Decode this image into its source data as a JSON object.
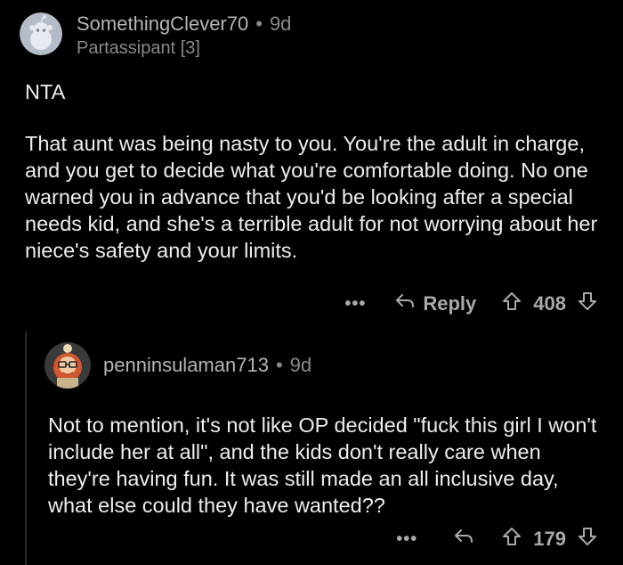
{
  "comment_1": {
    "author": "SomethingClever70",
    "separator": "•",
    "age": "9d",
    "flair": "Partassipant [3]",
    "paragraphs": [
      "NTA",
      "That aunt was being nasty to you. You're the adult in charge, and you get to decide what you're comfortable doing. No one warned you in advance that you'd be looking after a special needs kid, and she's a terrible adult for not worrying about her niece's safety and your limits."
    ],
    "more_label": "•••",
    "reply_label": "Reply",
    "score": "408"
  },
  "comment_2": {
    "author": "penninsulaman713",
    "separator": "•",
    "age": "9d",
    "text": "Not to mention, it's not like OP decided \"fuck this girl I won't include her at all\", and the kids don't really care when they're having fun. It was still made an all inclusive day, what else could they have wanted??",
    "more_label": "•••",
    "score": "179"
  },
  "colors": {
    "background": "#000000",
    "text": "#ededed",
    "muted": "#8a8a8a",
    "action": "#a9a9a9"
  }
}
